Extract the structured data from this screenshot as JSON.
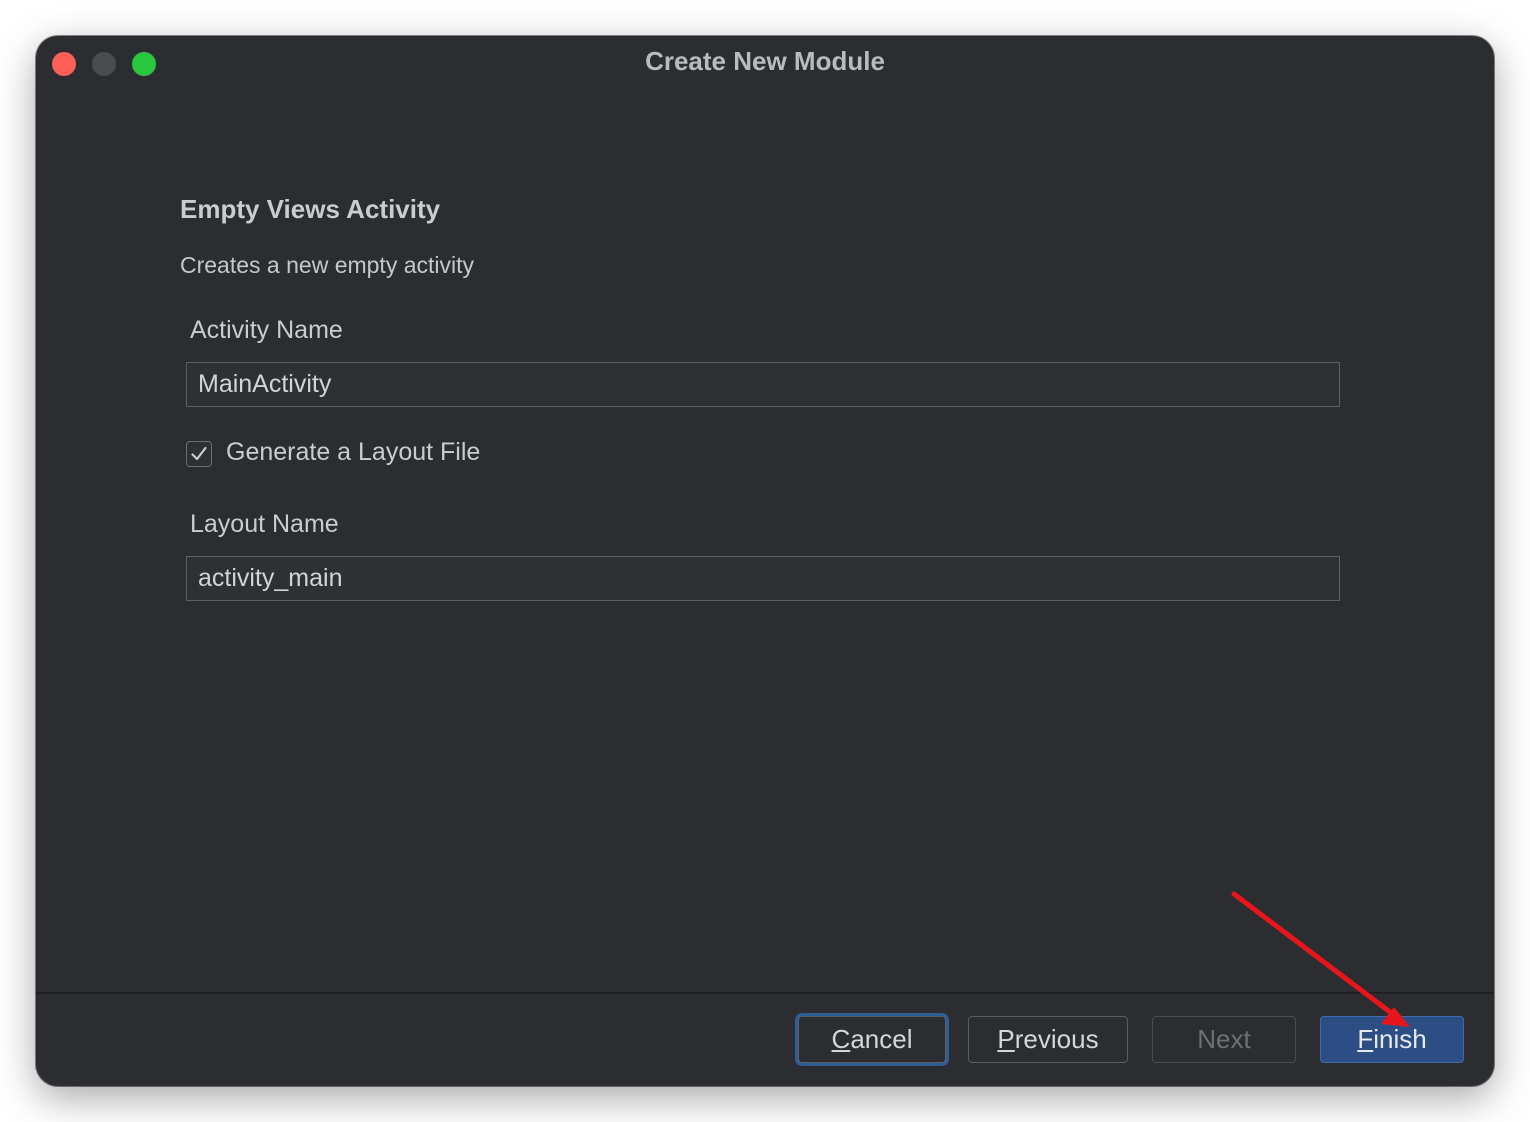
{
  "window": {
    "title": "Create New Module"
  },
  "template": {
    "heading": "Empty Views Activity",
    "description": "Creates a new empty activity"
  },
  "form": {
    "activity_name_label": "Activity Name",
    "activity_name_value": "MainActivity",
    "generate_layout_label": "Generate a Layout File",
    "generate_layout_checked": true,
    "layout_name_label": "Layout Name",
    "layout_name_value": "activity_main"
  },
  "buttons": {
    "cancel": {
      "mnemonic": "C",
      "rest": "ancel"
    },
    "previous": {
      "mnemonic": "P",
      "rest": "revious"
    },
    "next": {
      "label": "Next",
      "enabled": false
    },
    "finish": {
      "mnemonic": "F",
      "rest": "inish"
    }
  },
  "colors": {
    "window_bg": "#2b2d30",
    "accent_blue": "#2c4e85",
    "annotation_arrow": "#e8161b",
    "close": "#fe5f57",
    "zoom": "#28c840"
  },
  "icons": {
    "checkbox": "check-icon",
    "annotation": "red-arrow"
  }
}
